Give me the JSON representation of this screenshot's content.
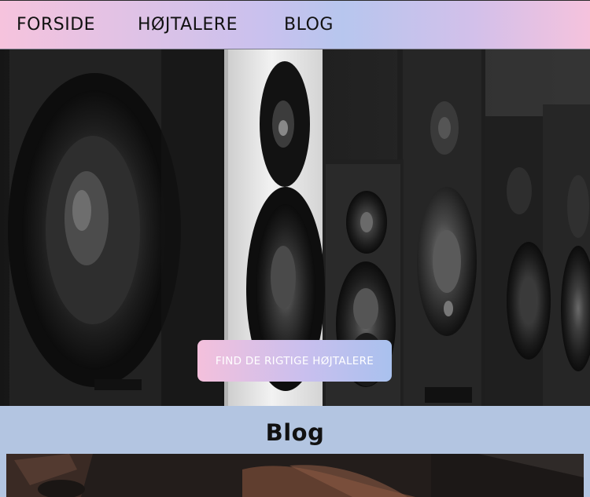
{
  "nav": {
    "items": [
      {
        "label": "FORSIDE"
      },
      {
        "label": "HØJTALERE"
      },
      {
        "label": "BLOG"
      }
    ]
  },
  "hero": {
    "cta_label": "FIND DE RIGTIGE HØJTALERE"
  },
  "blog": {
    "heading": "Blog"
  },
  "colors": {
    "nav_gradient_start": "#f6c3dd",
    "nav_gradient_mid": "#b7c6ee",
    "cta_gradient_start": "#f4c0dc",
    "cta_gradient_end": "#a9c1ee",
    "section_background": "#b3c5e1"
  }
}
